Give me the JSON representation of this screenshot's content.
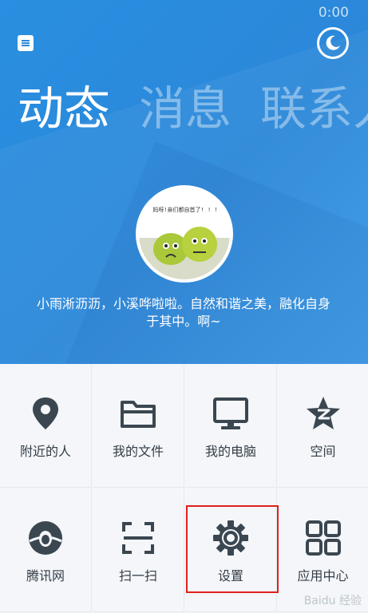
{
  "status": {
    "time": "0:00"
  },
  "header": {
    "menu_icon": "menu-icon",
    "night_icon": "moon-icon",
    "tabs": [
      {
        "label": "动态",
        "active": true
      },
      {
        "label": "消息",
        "active": false
      },
      {
        "label": "联系人",
        "active": false
      }
    ]
  },
  "profile": {
    "avatar_caption": "妈呀!亲们都自首了! ! !",
    "signature": "小雨淅沥沥，小溪哗啦啦。自然和谐之美，融化自身于其中。啊~"
  },
  "grid": {
    "items": [
      {
        "label": "附近的人",
        "icon": "location-pin-icon"
      },
      {
        "label": "我的文件",
        "icon": "folder-icon"
      },
      {
        "label": "我的电脑",
        "icon": "monitor-icon"
      },
      {
        "label": "空间",
        "icon": "qzone-star-icon"
      },
      {
        "label": "腾讯网",
        "icon": "tencent-penguin-icon"
      },
      {
        "label": "扫一扫",
        "icon": "scan-icon"
      },
      {
        "label": "设置",
        "icon": "gear-icon"
      },
      {
        "label": "应用中心",
        "icon": "app-grid-icon"
      }
    ]
  },
  "watermark": "Baidu 经验",
  "colors": {
    "header_blue": "#2b87d9",
    "icon_dark": "#3b4750",
    "highlight_red": "#e0211e"
  }
}
